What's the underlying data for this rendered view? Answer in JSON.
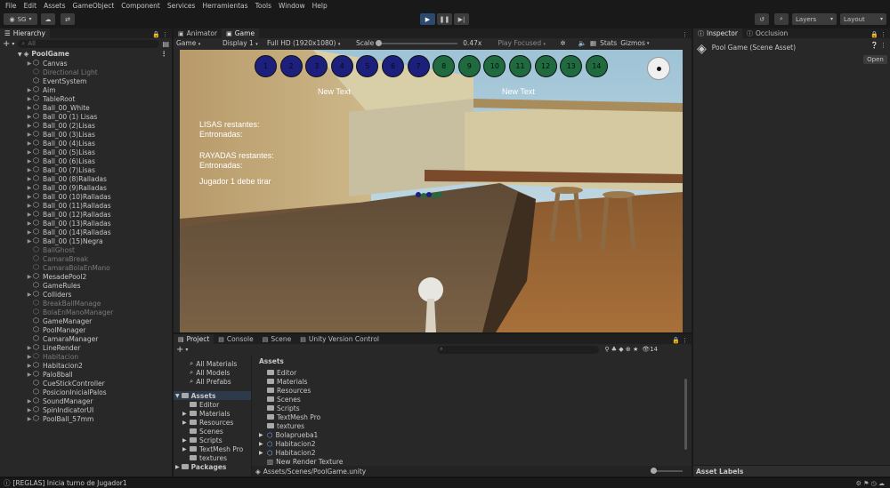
{
  "menu": [
    "File",
    "Edit",
    "Assets",
    "GameObject",
    "Component",
    "Services",
    "Herramientas",
    "Tools",
    "Window",
    "Help"
  ],
  "toolbar": {
    "account": "SG",
    "layers_label": "Layers",
    "layout_label": "Layout"
  },
  "hierarchy": {
    "tab_label": "Hierarchy",
    "search_placeholder": "All",
    "root": "PoolGame",
    "items": [
      {
        "label": "Canvas",
        "dim": false,
        "arrow": true
      },
      {
        "label": "Directional Light",
        "dim": true,
        "arrow": false
      },
      {
        "label": "EventSystem",
        "dim": false,
        "arrow": false
      },
      {
        "label": "Aim",
        "dim": false,
        "arrow": true
      },
      {
        "label": "TableRoot",
        "dim": false,
        "arrow": true
      },
      {
        "label": "Ball_00_White",
        "dim": false,
        "arrow": true
      },
      {
        "label": "Ball_00 (1) Lisas",
        "dim": false,
        "arrow": true
      },
      {
        "label": "Ball_00 (2)Lisas",
        "dim": false,
        "arrow": true
      },
      {
        "label": "Ball_00 (3)Lisas",
        "dim": false,
        "arrow": true
      },
      {
        "label": "Ball_00 (4)Lisas",
        "dim": false,
        "arrow": true
      },
      {
        "label": "Ball_00 (5)Lisas",
        "dim": false,
        "arrow": true
      },
      {
        "label": "Ball_00 (6)Lisas",
        "dim": false,
        "arrow": true
      },
      {
        "label": "Ball_00 (7)Lisas",
        "dim": false,
        "arrow": true
      },
      {
        "label": "Ball_00 (8)Ralladas",
        "dim": false,
        "arrow": true
      },
      {
        "label": "Ball_00 (9)Ralladas",
        "dim": false,
        "arrow": true
      },
      {
        "label": "Ball_00 (10)Ralladas",
        "dim": false,
        "arrow": true
      },
      {
        "label": "Ball_00 (11)Ralladas",
        "dim": false,
        "arrow": true
      },
      {
        "label": "Ball_00 (12)Ralladas",
        "dim": false,
        "arrow": true
      },
      {
        "label": "Ball_00 (13)Ralladas",
        "dim": false,
        "arrow": true
      },
      {
        "label": "Ball_00 (14)Ralladas",
        "dim": false,
        "arrow": true
      },
      {
        "label": "Ball_00 (15)Negra",
        "dim": false,
        "arrow": true
      },
      {
        "label": "BallGhost",
        "dim": true,
        "arrow": false
      },
      {
        "label": "CamaraBreak",
        "dim": true,
        "arrow": false
      },
      {
        "label": "CamaraBolaEnMano",
        "dim": true,
        "arrow": false
      },
      {
        "label": "MesadePool2",
        "dim": false,
        "arrow": true
      },
      {
        "label": "GameRules",
        "dim": false,
        "arrow": false
      },
      {
        "label": "Colliders",
        "dim": false,
        "arrow": true
      },
      {
        "label": "BreakBallManage",
        "dim": true,
        "arrow": false
      },
      {
        "label": "BolaEnManoManager",
        "dim": true,
        "arrow": false
      },
      {
        "label": "GameManager",
        "dim": false,
        "arrow": false
      },
      {
        "label": "PoolManager",
        "dim": false,
        "arrow": false
      },
      {
        "label": "CamaraManager",
        "dim": false,
        "arrow": false
      },
      {
        "label": "LineRender",
        "dim": false,
        "arrow": true
      },
      {
        "label": "Habitacion",
        "dim": true,
        "arrow": true
      },
      {
        "label": "Habitacion2",
        "dim": false,
        "arrow": true
      },
      {
        "label": "Palo8ball",
        "dim": false,
        "arrow": true
      },
      {
        "label": "CueStickController",
        "dim": false,
        "arrow": false
      },
      {
        "label": "PosicionInicialPalos",
        "dim": false,
        "arrow": false
      },
      {
        "label": "SoundManager",
        "dim": false,
        "arrow": true
      },
      {
        "label": "SpinIndicatorUI",
        "dim": false,
        "arrow": true
      },
      {
        "label": "PoolBall_57mm",
        "dim": false,
        "arrow": true
      }
    ]
  },
  "center_tabs": [
    {
      "label": "Animator",
      "active": false
    },
    {
      "label": "Game",
      "active": true
    }
  ],
  "game_bar": {
    "mode": "Game",
    "display": "Display 1",
    "resolution": "Full HD (1920x1080)",
    "scale_label": "Scale",
    "scale_value": "0.47x",
    "play_focused": "Play Focused",
    "stats": "Stats",
    "gizmos": "Gizmos"
  },
  "game_view": {
    "balls": [
      {
        "n": "1",
        "kind": "solid"
      },
      {
        "n": "2",
        "kind": "solid"
      },
      {
        "n": "3",
        "kind": "solid"
      },
      {
        "n": "4",
        "kind": "solid"
      },
      {
        "n": "5",
        "kind": "solid"
      },
      {
        "n": "6",
        "kind": "solid"
      },
      {
        "n": "7",
        "kind": "solid"
      },
      {
        "n": "8",
        "kind": "stripe"
      },
      {
        "n": "9",
        "kind": "stripe"
      },
      {
        "n": "10",
        "kind": "stripe"
      },
      {
        "n": "11",
        "kind": "stripe"
      },
      {
        "n": "12",
        "kind": "stripe"
      },
      {
        "n": "13",
        "kind": "stripe"
      },
      {
        "n": "14",
        "kind": "stripe"
      }
    ],
    "new_text_left": "New Text",
    "new_text_right": "New Text",
    "lisas_restantes": "LISAS restantes:",
    "entronadas_1": "Entronadas:",
    "rayadas_restantes": "RAYADAS restantes:",
    "entronadas_2": "Entronadas:",
    "turn_text": "Jugador 1 debe tirar"
  },
  "inspector": {
    "tabs": [
      {
        "label": "Inspector",
        "active": true
      },
      {
        "label": "Occlusion",
        "active": false
      }
    ],
    "title": "Pool Game (Scene Asset)",
    "open_button": "Open",
    "footer": "Asset Labels"
  },
  "project": {
    "tabs": [
      {
        "label": "Project",
        "active": true
      },
      {
        "label": "Console",
        "active": false
      },
      {
        "label": "Scene",
        "active": false
      },
      {
        "label": "Unity Version Control",
        "active": false
      }
    ],
    "favorites": [
      "All Materials",
      "All Models",
      "All Prefabs"
    ],
    "tree_root": "Assets",
    "tree_items": [
      "Editor",
      "Materials",
      "Resources",
      "Scenes",
      "Scripts",
      "TextMesh Pro",
      "textures"
    ],
    "packages_label": "Packages",
    "assets_header": "Assets",
    "assets": [
      {
        "label": "Editor",
        "kind": "folder"
      },
      {
        "label": "Materials",
        "kind": "folder"
      },
      {
        "label": "Resources",
        "kind": "folder"
      },
      {
        "label": "Scenes",
        "kind": "folder"
      },
      {
        "label": "Scripts",
        "kind": "folder"
      },
      {
        "label": "TextMesh Pro",
        "kind": "folder"
      },
      {
        "label": "textures",
        "kind": "folder"
      },
      {
        "label": "Bolaprueba1",
        "kind": "model"
      },
      {
        "label": "Habitacion2",
        "kind": "model"
      },
      {
        "label": "Habitacion2",
        "kind": "prefab"
      },
      {
        "label": "New Render Texture",
        "kind": "texture"
      }
    ],
    "path": "Assets/Scenes/PoolGame.unity",
    "count_badge": "14"
  },
  "status": {
    "message": "[REGLAS] Inicia turno de Jugador1"
  }
}
